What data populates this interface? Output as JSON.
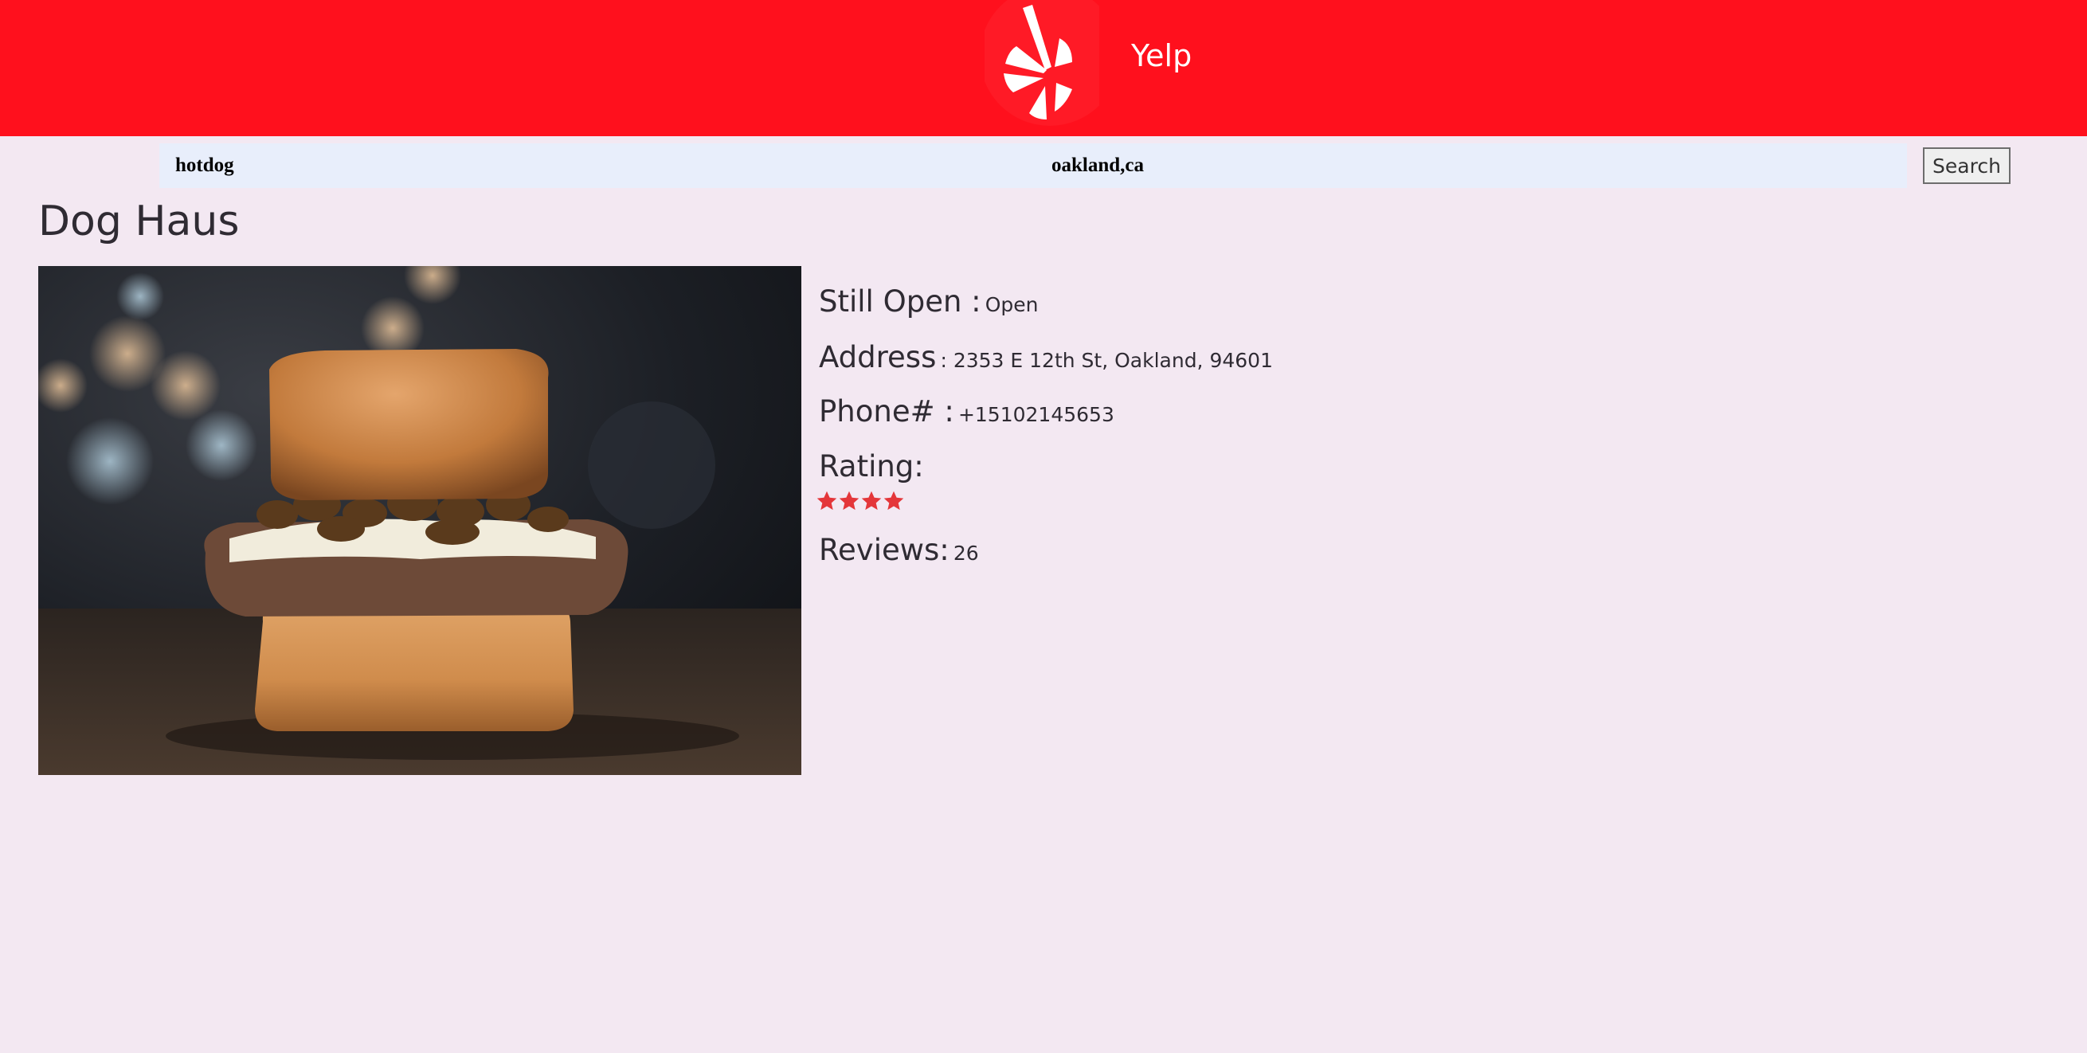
{
  "header": {
    "brand": "Yelp",
    "logo_icon": "yelp-burst-logo",
    "background_color": "#ff101d"
  },
  "search": {
    "term_value": "hotdog",
    "location_value": "oakland,ca",
    "button_label": "Search"
  },
  "business": {
    "name": "Dog Haus",
    "image_icon": "burger-photo",
    "still_open_label": "Still Open :",
    "still_open_value": "Open",
    "address_label": "Address",
    "address_value": ": 2353 E 12th St, Oakland, 94601",
    "phone_label": "Phone# :",
    "phone_value": "+15102145653",
    "rating_label": "Rating:",
    "rating_value": 4,
    "rating_max": 5,
    "star_color": "#e4363a",
    "reviews_label": "Reviews:",
    "reviews_value": "26"
  }
}
